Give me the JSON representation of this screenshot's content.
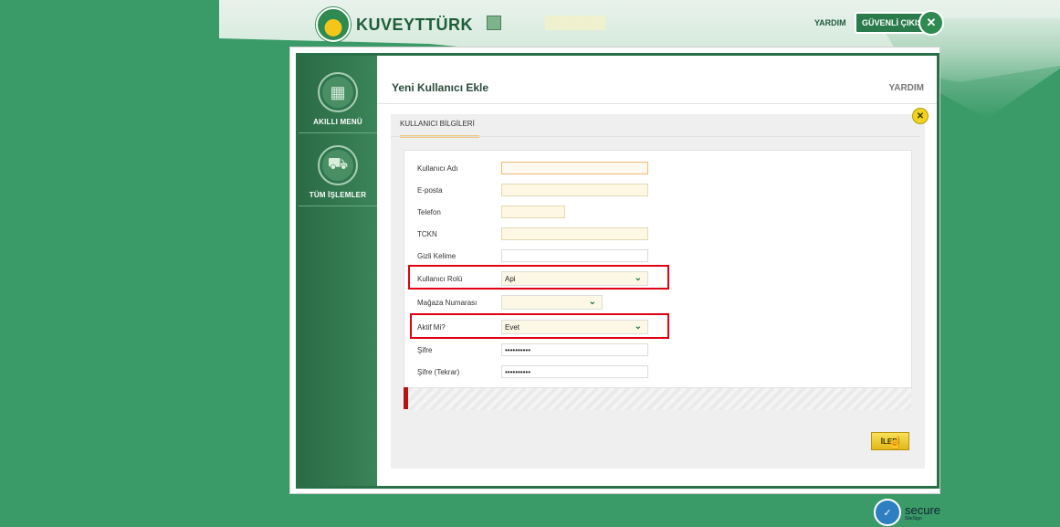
{
  "header": {
    "brand": "KUVEYTTÜRK",
    "help_label": "YARDIM",
    "logout_label": "GÜVENLİ ÇIKIŞ"
  },
  "sidebar": {
    "items": [
      {
        "label": "AKILLI MENÜ",
        "icon": "grid-icon"
      },
      {
        "label": "TÜM İŞLEMLER",
        "icon": "cart-icon"
      }
    ]
  },
  "page": {
    "title": "Yeni Kullanıcı Ekle",
    "help_label": "YARDIM",
    "close_icon": "close-icon"
  },
  "tabs": [
    {
      "label": "KULLANICI BİLGİLERİ",
      "active": true
    }
  ],
  "form": {
    "fields": [
      {
        "label": "Kullanıcı Adı",
        "value": ""
      },
      {
        "label": "E-posta",
        "value": ""
      },
      {
        "label": "Telefon",
        "value": ""
      },
      {
        "label": "TCKN",
        "value": ""
      },
      {
        "label": "Gizli Kelime",
        "value": ""
      },
      {
        "label": "Kullanıcı Rolü",
        "value": "Api"
      },
      {
        "label": "Mağaza Numarası",
        "value": ""
      },
      {
        "label": "Aktif Mi?",
        "value": "Evet"
      },
      {
        "label": "Şifre",
        "value": "••••••••••"
      },
      {
        "label": "Şifre (Tekrar)",
        "value": "••••••••••"
      }
    ]
  },
  "actions": {
    "next_label": "İLERİ"
  },
  "footer": {
    "secure_label": "secure",
    "secure_sub": "SiteSign"
  },
  "colors": {
    "brand_green": "#3a9b68",
    "highlight_red": "#e20012",
    "button_yellow": "#f0d31d"
  }
}
